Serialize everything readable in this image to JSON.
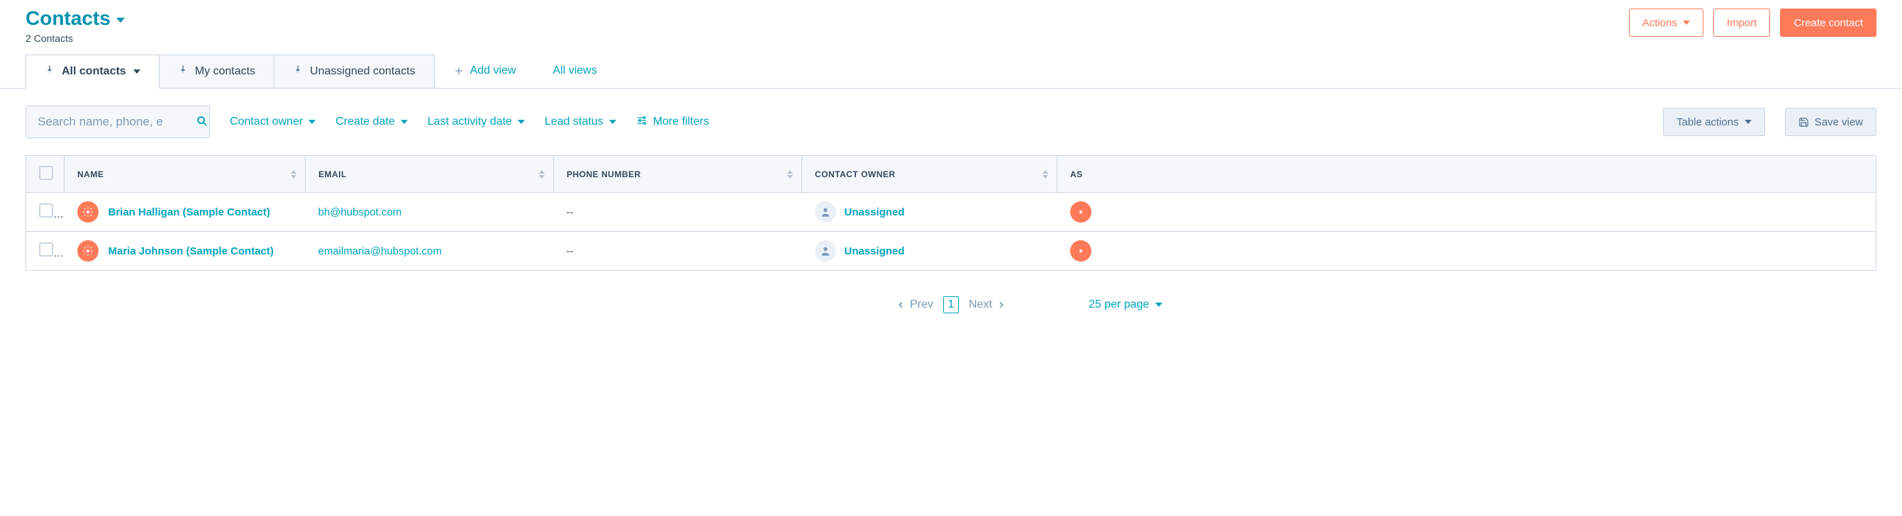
{
  "header": {
    "title": "Contacts",
    "subtitle": "2 Contacts",
    "actions_label": "Actions",
    "import_label": "Import",
    "create_label": "Create contact"
  },
  "tabs": {
    "all": "All contacts",
    "my": "My contacts",
    "unassigned": "Unassigned contacts",
    "add_view": "Add view",
    "all_views": "All views"
  },
  "filters": {
    "search_placeholder": "Search name, phone, e",
    "contact_owner": "Contact owner",
    "create_date": "Create date",
    "last_activity": "Last activity date",
    "lead_status": "Lead status",
    "more_filters": "More filters",
    "table_actions": "Table actions",
    "save_view": "Save view"
  },
  "columns": {
    "name": "NAME",
    "email": "EMAIL",
    "phone": "PHONE NUMBER",
    "owner": "CONTACT OWNER",
    "assoc": "AS"
  },
  "rows": [
    {
      "name": "Brian Halligan (Sample Contact)",
      "email": "bh@hubspot.com",
      "phone": "--",
      "owner": "Unassigned"
    },
    {
      "name": "Maria Johnson (Sample Contact)",
      "email": "emailmaria@hubspot.com",
      "phone": "--",
      "owner": "Unassigned"
    }
  ],
  "pagination": {
    "prev": "Prev",
    "next": "Next",
    "page": "1",
    "page_size": "25 per page"
  }
}
